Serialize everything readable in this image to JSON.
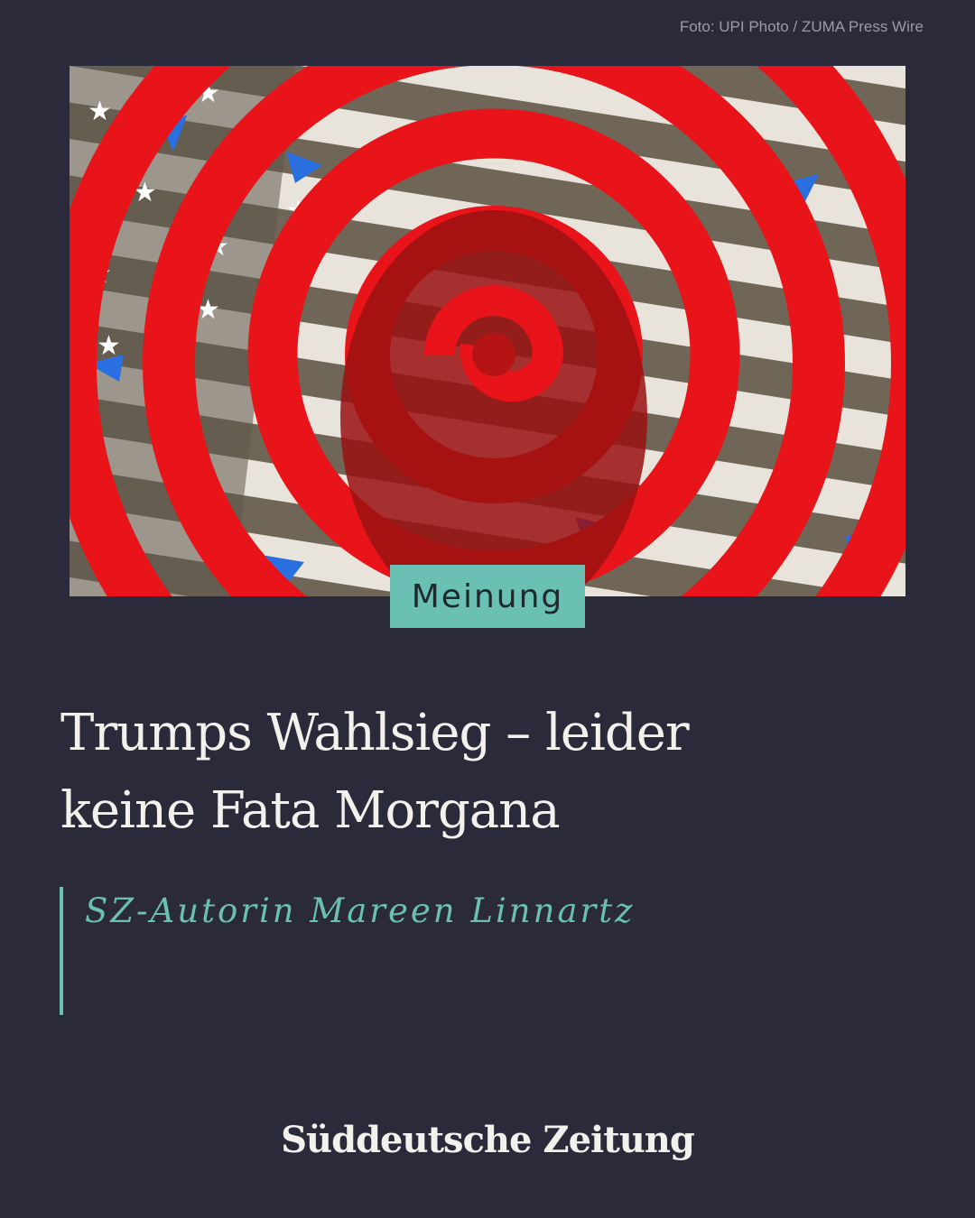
{
  "photo_credit": "Foto: UPI Photo / ZUMA Press Wire",
  "category_badge": "Meinung",
  "headline": {
    "line1": "Trumps Wahlsieg – leider",
    "line2": "keine Fata Morgana"
  },
  "author": "SZ-Autorin Mareen Linnartz",
  "logo": "Süddeutsche Zeitung",
  "colors": {
    "background": "#2a2a3a",
    "accent": "#6bc0b4",
    "spiral_red": "#e8141a",
    "flag_blue": "#2a6fe0"
  },
  "image_icon": "spiral-flag-collage"
}
